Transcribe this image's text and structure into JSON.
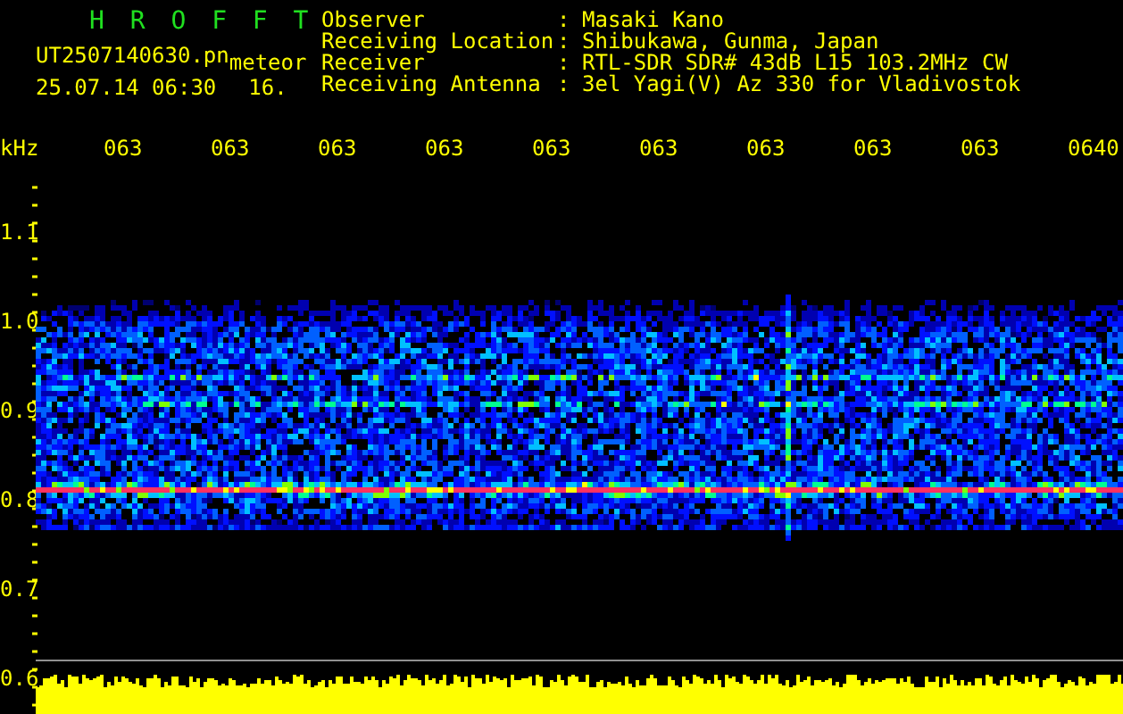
{
  "header": {
    "title": "H R O F F T",
    "filename": "UT2507140630.pn",
    "mode": "meteor",
    "date_time": "25.07.14 06:30",
    "value": "16."
  },
  "info": [
    {
      "label": "Observer",
      "separator": ":",
      "value": "Masaki Kano"
    },
    {
      "label": "Receiving Location",
      "separator": ":",
      "value": "Shibukawa, Gunma, Japan"
    },
    {
      "label": "Receiver",
      "separator": ":",
      "value": "RTL-SDR SDR# 43dB L15 103.2MHz CW"
    },
    {
      "label": "Receiving Antenna",
      "separator": ":",
      "value": "3el Yagi(V) Az 330 for Vladivostok"
    }
  ],
  "time_axis": {
    "labels": [
      "063",
      "063",
      "063",
      "063",
      "063",
      "063",
      "063",
      "063",
      "063",
      "0640"
    ]
  },
  "frequency_axis": {
    "unit": "kHz",
    "labels": [
      "1.1",
      "1.0",
      "0.9",
      "0.8",
      "0.7",
      "0.6"
    ]
  }
}
